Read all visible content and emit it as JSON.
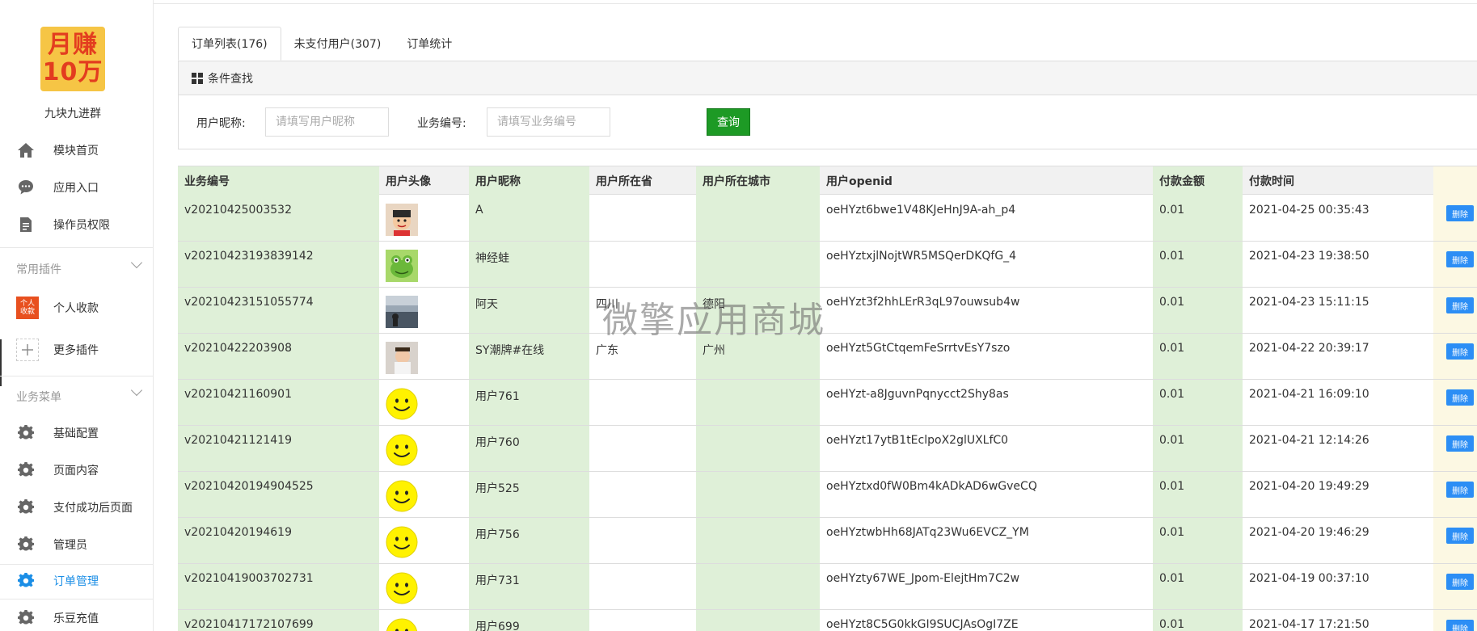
{
  "app": {
    "logo_line1": "月赚",
    "logo_line2": "10万",
    "name": "九块九进群"
  },
  "sidebar": {
    "top_items": [
      {
        "label": "模块首页",
        "icon": "home-icon"
      },
      {
        "label": "应用入口",
        "icon": "chat-icon"
      },
      {
        "label": "操作员权限",
        "icon": "document-icon"
      }
    ],
    "plugins_group": "常用插件",
    "plugins": [
      {
        "label": "个人收款",
        "icon": "payment-plugin-icon",
        "icon_text": "个人收款"
      },
      {
        "label": "更多插件",
        "icon": "plus-icon"
      }
    ],
    "business_group": "业务菜单",
    "business": [
      {
        "label": "基础配置",
        "icon": "gear-icon"
      },
      {
        "label": "页面内容",
        "icon": "gear-icon"
      },
      {
        "label": "支付成功后页面",
        "icon": "gear-icon"
      },
      {
        "label": "管理员",
        "icon": "gear-icon"
      },
      {
        "label": "订单管理",
        "icon": "gear-icon",
        "active": true
      },
      {
        "label": "乐豆充值",
        "icon": "gear-icon"
      }
    ]
  },
  "tabs": [
    {
      "label": "订单列表(176)",
      "active": true
    },
    {
      "label": "未支付用户(307)"
    },
    {
      "label": "订单统计"
    }
  ],
  "search": {
    "panel_title": "条件查找",
    "nickname_label": "用户昵称:",
    "nickname_placeholder": "请填写用户昵称",
    "order_label": "业务编号:",
    "order_placeholder": "请填写业务编号",
    "query_button": "查询"
  },
  "table": {
    "headers": [
      "业务编号",
      "用户头像",
      "用户昵称",
      "用户所在省",
      "用户所在城市",
      "用户openid",
      "付款金额",
      "付款时间"
    ],
    "delete_label": "删除",
    "rows": [
      {
        "order_no": "v20210425003532",
        "avatar": "cartoon-avatar",
        "nickname": "A",
        "province": "",
        "city": "",
        "openid": "oeHYzt6bwe1V48KJeHnJ9A-ah_p4",
        "amount": "0.01",
        "time": "2021-04-25 00:35:43"
      },
      {
        "order_no": "v20210423193839142",
        "avatar": "frog-avatar",
        "nickname": "神经蛙",
        "province": "",
        "city": "",
        "openid": "oeHYztxjlNojtWR5MSQerDKQfG_4",
        "amount": "0.01",
        "time": "2021-04-23 19:38:50"
      },
      {
        "order_no": "v20210423151055774",
        "avatar": "photo-avatar",
        "nickname": "阿天",
        "province": "四川",
        "city": "德阳",
        "openid": "oeHYzt3f2hhLErR3qL97ouwsub4w",
        "amount": "0.01",
        "time": "2021-04-23 15:11:15"
      },
      {
        "order_no": "v20210422203908",
        "avatar": "baby-avatar",
        "nickname": "SY潮牌#在线",
        "province": "广东",
        "city": "广州",
        "openid": "oeHYzt5GtCtqemFeSrrtvEsY7szo",
        "amount": "0.01",
        "time": "2021-04-22 20:39:17"
      },
      {
        "order_no": "v20210421160901",
        "avatar": "smiley",
        "nickname": "用户761",
        "province": "",
        "city": "",
        "openid": "oeHYzt-a8JguvnPqnycct2Shy8as",
        "amount": "0.01",
        "time": "2021-04-21 16:09:10"
      },
      {
        "order_no": "v20210421121419",
        "avatar": "smiley",
        "nickname": "用户760",
        "province": "",
        "city": "",
        "openid": "oeHYzt17ytB1tEclpoX2glUXLfC0",
        "amount": "0.01",
        "time": "2021-04-21 12:14:26"
      },
      {
        "order_no": "v20210420194904525",
        "avatar": "smiley",
        "nickname": "用户525",
        "province": "",
        "city": "",
        "openid": "oeHYztxd0fW0Bm4kADkAD6wGveCQ",
        "amount": "0.01",
        "time": "2021-04-20 19:49:29"
      },
      {
        "order_no": "v20210420194619",
        "avatar": "smiley",
        "nickname": "用户756",
        "province": "",
        "city": "",
        "openid": "oeHYztwbHh68JATq23Wu6EVCZ_YM",
        "amount": "0.01",
        "time": "2021-04-20 19:46:29"
      },
      {
        "order_no": "v20210419003702731",
        "avatar": "smiley",
        "nickname": "用户731",
        "province": "",
        "city": "",
        "openid": "oeHYzty67WE_Jpom-ElejtHm7C2w",
        "amount": "0.01",
        "time": "2021-04-19 00:37:10"
      },
      {
        "order_no": "v20210417172107699",
        "avatar": "smiley",
        "nickname": "用户699",
        "province": "",
        "city": "",
        "openid": "oeHYzt8C5G0kkGI9SUCJAsOgI7ZE",
        "amount": "0.01",
        "time": "2021-04-17 17:21:50"
      }
    ]
  },
  "watermark": "微擎应用商城",
  "colors": {
    "accent": "#1b8ee6",
    "query_button": "#1d9a25",
    "column_green": "#dff0d8",
    "column_cream": "#fcf8e3",
    "delete_button": "#2c8ef5"
  }
}
